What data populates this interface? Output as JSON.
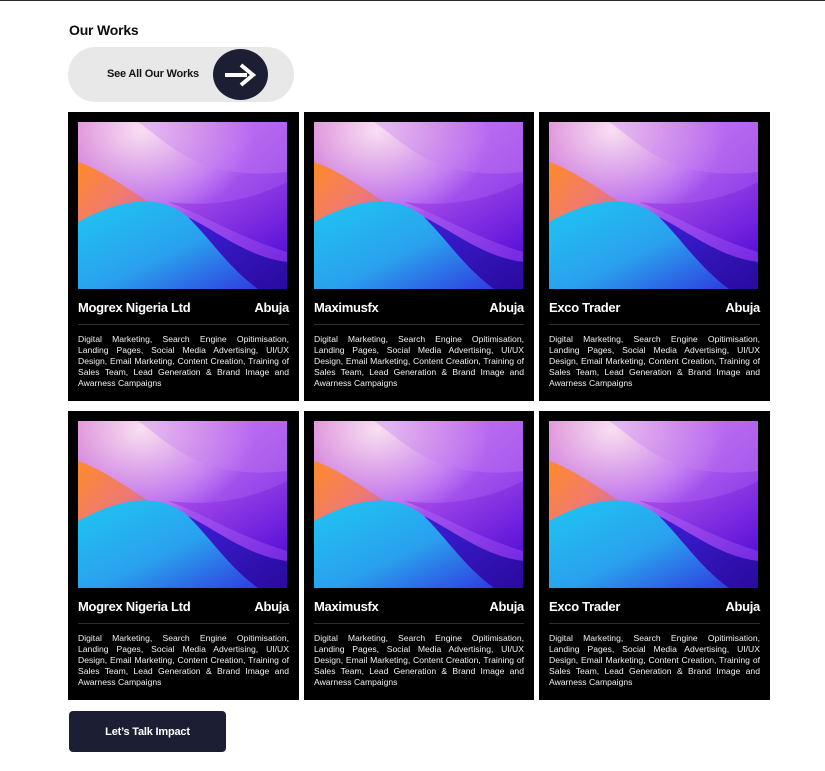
{
  "section": {
    "title": "Our Works"
  },
  "see_all": {
    "label": "See All Our Works",
    "icon": "arrow-right-icon"
  },
  "works": [
    {
      "name": "Mogrex Nigeria Ltd",
      "location": "Abuja",
      "description": "Digital Marketing, Search Engine Opitimisation, Landing Pages, Social Media Advertising, UI/UX Design, Email Marketing, Content Creation, Training of Sales Team, Lead Generation & Brand Image and Awarness Campaigns"
    },
    {
      "name": "Maximusfx",
      "location": "Abuja",
      "description": "Digital Marketing, Search Engine Opitimisation, Landing Pages, Social Media Advertising, UI/UX Design, Email Marketing, Content Creation, Training of Sales Team, Lead Generation & Brand Image and Awarness Campaigns"
    },
    {
      "name": "Exco Trader",
      "location": "Abuja",
      "description": "Digital Marketing, Search Engine Opitimisation, Landing Pages, Social Media Advertising, UI/UX Design, Email Marketing, Content Creation, Training of Sales Team, Lead Generation & Brand Image and Awarness Campaigns"
    },
    {
      "name": "Mogrex Nigeria Ltd",
      "location": "Abuja",
      "description": "Digital Marketing, Search Engine Opitimisation, Landing Pages, Social Media Advertising, UI/UX Design, Email Marketing, Content Creation, Training of Sales Team, Lead Generation & Brand Image and Awarness Campaigns"
    },
    {
      "name": "Maximusfx",
      "location": "Abuja",
      "description": "Digital Marketing, Search Engine Opitimisation, Landing Pages, Social Media Advertising, UI/UX Design, Email Marketing, Content Creation, Training of Sales Team, Lead Generation & Brand Image and Awarness Campaigns"
    },
    {
      "name": "Exco Trader",
      "location": "Abuja",
      "description": "Digital Marketing, Search Engine Opitimisation, Landing Pages, Social Media Advertising, UI/UX Design, Email Marketing, Content Creation, Training of Sales Team, Lead Generation & Brand Image and Awarness Campaigns"
    }
  ],
  "cta": {
    "label": "Let’s Talk Impact"
  },
  "colors": {
    "card_bg": "#000000",
    "button_dark": "#1c1f33",
    "pill_bg": "#e8e8e8"
  }
}
